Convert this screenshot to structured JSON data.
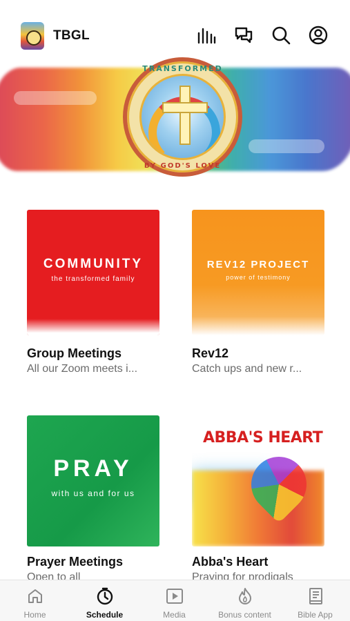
{
  "header": {
    "title": "TBGL",
    "icons": [
      "equalizer-icon",
      "chat-icon",
      "search-icon",
      "account-icon"
    ]
  },
  "banner": {
    "badge_top_text": "TRANSFORMED",
    "badge_bottom_text": "BY GOD'S LOVE"
  },
  "cards": [
    {
      "title": "Group Meetings",
      "subtitle": "All our Zoom meets i...",
      "image_heading": "COMMUNITY",
      "image_subheading": "the transformed family",
      "color": "#e51d20"
    },
    {
      "title": "Rev12",
      "subtitle": "Catch ups and new r...",
      "image_heading": "REV12 PROJECT",
      "image_subheading": "power of testimony",
      "color": "#f7941d"
    },
    {
      "title": "Prayer Meetings",
      "subtitle": "Open to all",
      "image_heading": "PRAY",
      "image_subheading": "with us and for us",
      "color": "#1ea650"
    },
    {
      "title": "Abba's Heart",
      "subtitle": "Praying for prodigals",
      "image_heading": "ABBA'S HEART",
      "color": "#d62020"
    }
  ],
  "bottom_nav": {
    "active": "Schedule",
    "items": [
      {
        "label": "Home",
        "icon": "home-icon"
      },
      {
        "label": "Schedule",
        "icon": "clock-icon"
      },
      {
        "label": "Media",
        "icon": "play-icon"
      },
      {
        "label": "Bonus content",
        "icon": "flame-icon"
      },
      {
        "label": "Bible App",
        "icon": "book-icon"
      }
    ]
  }
}
